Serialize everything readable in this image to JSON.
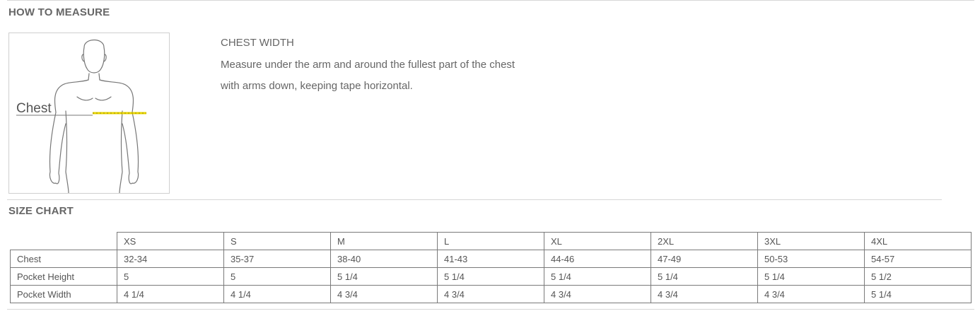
{
  "how_to_measure": {
    "title": "HOW TO MEASURE",
    "figure_label": "Chest",
    "heading": "CHEST WIDTH",
    "lines": [
      "Measure under the arm and around the fullest part of the chest",
      "with arms down, keeping tape horizontal."
    ]
  },
  "size_chart": {
    "title": "SIZE CHART",
    "sizes": [
      "XS",
      "S",
      "M",
      "L",
      "XL",
      "2XL",
      "3XL",
      "4XL"
    ],
    "rows": [
      {
        "label": "Chest",
        "values": [
          "32-34",
          "35-37",
          "38-40",
          "41-43",
          "44-46",
          "47-49",
          "50-53",
          "54-57"
        ]
      },
      {
        "label": "Pocket Height",
        "values": [
          "5",
          "5",
          "5 1/4",
          "5 1/4",
          "5 1/4",
          "5 1/4",
          "5 1/4",
          "5 1/2"
        ]
      },
      {
        "label": "Pocket Width",
        "values": [
          "4 1/4",
          "4 1/4",
          "4 3/4",
          "4 3/4",
          "4 3/4",
          "4 3/4",
          "4 3/4",
          "5 1/4"
        ]
      }
    ]
  },
  "colors": {
    "tape": "#e8d400",
    "text": "#666666",
    "rule": "#d7d7d7"
  }
}
